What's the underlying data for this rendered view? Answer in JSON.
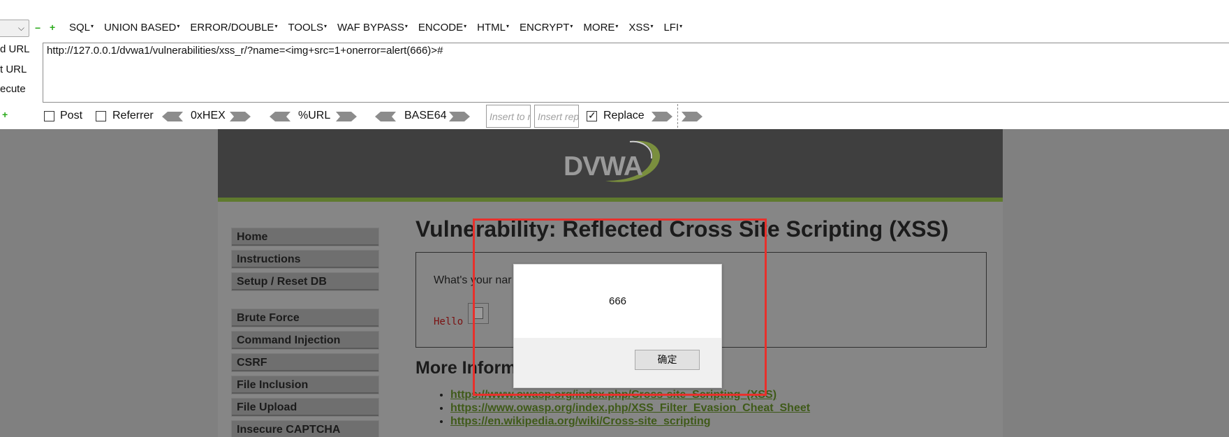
{
  "hackbar": {
    "select_value": "",
    "minus_label": "−",
    "plus_label": "+",
    "menu": [
      "SQL",
      "UNION BASED",
      "ERROR/DOUBLE",
      "TOOLS",
      "WAF BYPASS",
      "ENCODE",
      "HTML",
      "ENCRYPT",
      "MORE",
      "XSS",
      "LFI"
    ],
    "side_actions": [
      "d URL",
      "t URL",
      "ecute"
    ],
    "url_value": "http://127.0.0.1/dvwa1/vulnerabilities/xss_r/?name=<img+src=1+onerror=alert(666)>#",
    "post_label": "Post",
    "referrer_label": "Referrer",
    "hex_label": "0xHEX",
    "url_label": "%URL",
    "base64_label": "BASE64",
    "insert_to_placeholder": "Insert to replace",
    "insert_rep_placeholder": "Insert replace",
    "replace_label": "Replace",
    "replace_checked": true
  },
  "dvwa": {
    "logo_text": "DVWA",
    "menu": [
      "Home",
      "Instructions",
      "Setup / Reset DB"
    ],
    "menu2": [
      "Brute Force",
      "Command Injection",
      "CSRF",
      "File Inclusion",
      "File Upload",
      "Insecure CAPTCHA"
    ],
    "title": "Vulnerability: Reflected Cross Site Scripting (XSS)",
    "name_question": "What's your nar",
    "hello": "Hello",
    "more_info": "More Inform",
    "links": [
      "https://www.owasp.org/index.php/Cross-site_Scripting_(XSS)",
      "https://www.owasp.org/index.php/XSS_Filter_Evasion_Cheat_Sheet",
      "https://en.wikipedia.org/wiki/Cross-site_scripting"
    ]
  },
  "dialog": {
    "message": "666",
    "ok_label": "确定"
  },
  "colors": {
    "highlight": "#e8302c",
    "hackbar_green": "#2bab1c",
    "dvwa_link": "#3f5a19"
  }
}
